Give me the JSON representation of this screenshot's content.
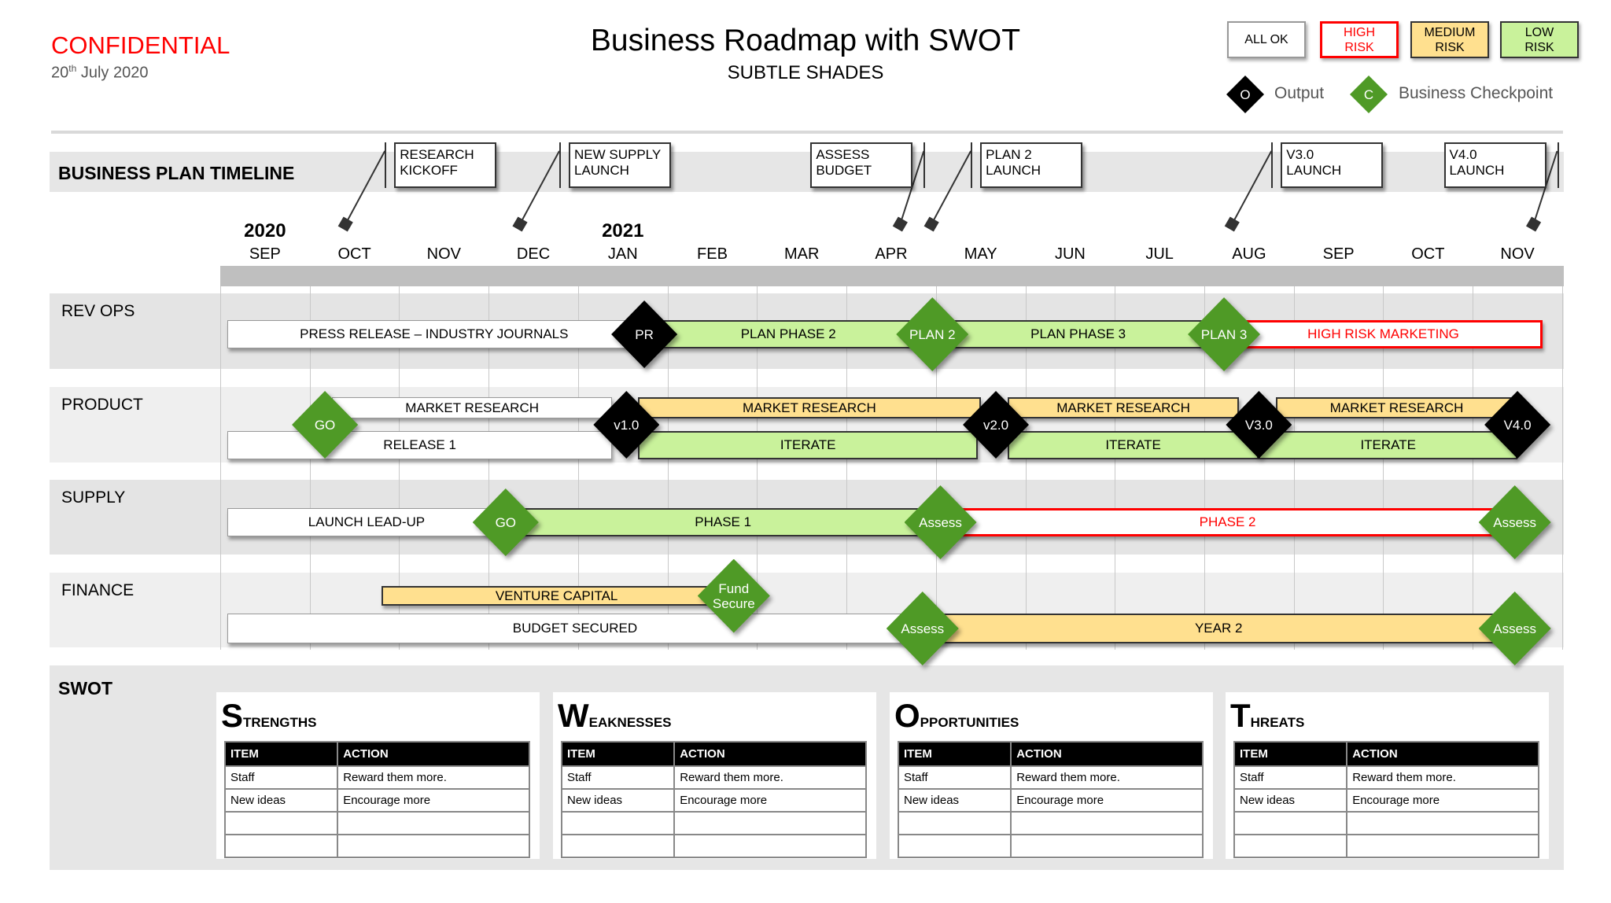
{
  "header": {
    "confidential": "CONFIDENTIAL",
    "date_day": "20",
    "date_suffix": "th",
    "date_rest": " July 2020",
    "title": "Business Roadmap with SWOT",
    "subtitle": "SUBTLE SHADES"
  },
  "legend": {
    "status": [
      {
        "key": "ok",
        "label": "ALL OK"
      },
      {
        "key": "high",
        "label": "HIGH RISK"
      },
      {
        "key": "medium",
        "label": "MEDIUM RISK"
      },
      {
        "key": "low",
        "label": "LOW RISK"
      }
    ],
    "output": {
      "symbol": "O",
      "label": "Output"
    },
    "checkpoint": {
      "symbol": "C",
      "label": "Business Checkpoint"
    }
  },
  "colors": {
    "high_risk": "#ff0000",
    "medium_risk": "#ffe08f",
    "low_risk": "#c9f29b",
    "checkpoint": "#4f9a26",
    "output": "#000000",
    "band": "#e6e6e6"
  },
  "timeline": {
    "title": "BUSINESS PLAN TIMELINE",
    "years": [
      {
        "label": "2020",
        "month_index": 0
      },
      {
        "label": "2021",
        "month_index": 4
      }
    ],
    "months": [
      "SEP",
      "OCT",
      "NOV",
      "DEC",
      "JAN",
      "FEB",
      "MAR",
      "APR",
      "MAY",
      "JUN",
      "JUL",
      "AUG",
      "SEP",
      "OCT",
      "NOV"
    ],
    "milestones": [
      {
        "label": "RESEARCH KICKOFF",
        "line1": "RESEARCH",
        "line2": "KICKOFF",
        "month": 1.4
      },
      {
        "label": "NEW SUPPLY LAUNCH",
        "line1": "NEW SUPPLY",
        "line2": "LAUNCH",
        "month": 3.35
      },
      {
        "label": "ASSESS BUDGET",
        "line1": "ASSESS",
        "line2": "BUDGET",
        "month": 7.6
      },
      {
        "label": "PLAN 2 LAUNCH",
        "line1": "PLAN 2",
        "line2": "LAUNCH",
        "month": 7.95
      },
      {
        "label": "V3.0 LAUNCH",
        "line1": "V3.0",
        "line2": "LAUNCH",
        "month": 11.31
      },
      {
        "label": "V4.0 LAUNCH",
        "line1": "V4.0",
        "line2": "LAUNCH",
        "month": 14.68
      }
    ]
  },
  "rows": [
    {
      "label": "REV OPS",
      "bars": [
        {
          "label": "PRESS RELEASE – INDUSTRY JOURNALS",
          "status": "ok",
          "start": 0.08,
          "end": 4.7,
          "lane": "mid"
        },
        {
          "label": "PLAN PHASE 2",
          "status": "low",
          "start": 4.74,
          "end": 7.96,
          "lane": "mid"
        },
        {
          "label": "PLAN PHASE 3",
          "status": "low",
          "start": 7.96,
          "end": 11.22,
          "lane": "mid"
        },
        {
          "label": "HIGH RISK MARKETING",
          "status": "high",
          "start": 11.22,
          "end": 14.78,
          "lane": "mid"
        }
      ],
      "markers": [
        {
          "type": "output",
          "label": "PR",
          "month": 4.74,
          "lane": "mid"
        },
        {
          "type": "checkpoint",
          "label": "PLAN 2",
          "month": 7.96,
          "lane": "mid"
        },
        {
          "type": "checkpoint",
          "label": "PLAN 3",
          "month": 11.22,
          "lane": "mid"
        }
      ]
    },
    {
      "label": "PRODUCT",
      "bars": [
        {
          "label": "MARKET RESEARCH",
          "status": "ok",
          "start": 1.25,
          "end": 4.38,
          "lane": "top"
        },
        {
          "label": "RELEASE 1",
          "status": "ok",
          "start": 0.08,
          "end": 4.38,
          "lane": "bottom"
        },
        {
          "label": "MARKET RESEARCH",
          "status": "medium",
          "start": 4.67,
          "end": 8.5,
          "lane": "top"
        },
        {
          "label": "ITERATE",
          "status": "low",
          "start": 4.67,
          "end": 8.47,
          "lane": "bottom"
        },
        {
          "label": "MARKET RESEARCH",
          "status": "medium",
          "start": 8.8,
          "end": 11.39,
          "lane": "top"
        },
        {
          "label": "ITERATE",
          "status": "low",
          "start": 8.8,
          "end": 11.61,
          "lane": "bottom"
        },
        {
          "label": "MARKET RESEARCH",
          "status": "medium",
          "start": 11.8,
          "end": 14.5,
          "lane": "top"
        },
        {
          "label": "ITERATE",
          "status": "low",
          "start": 11.61,
          "end": 14.5,
          "lane": "bottom"
        }
      ],
      "markers": [
        {
          "type": "checkpoint",
          "label": "GO",
          "month": 1.17,
          "lane": "center"
        },
        {
          "type": "output",
          "label": "v1.0",
          "month": 4.54,
          "lane": "center"
        },
        {
          "type": "output",
          "label": "v2.0",
          "month": 8.67,
          "lane": "center"
        },
        {
          "type": "output",
          "label": "V3.0",
          "month": 11.61,
          "lane": "center"
        },
        {
          "type": "output",
          "label": "V4.0",
          "month": 14.5,
          "lane": "center"
        }
      ]
    },
    {
      "label": "SUPPLY",
      "bars": [
        {
          "label": "LAUNCH LEAD-UP",
          "status": "ok",
          "start": 0.08,
          "end": 3.19,
          "lane": "mid"
        },
        {
          "label": "PHASE 1",
          "status": "low",
          "start": 3.19,
          "end": 8.05,
          "lane": "mid"
        },
        {
          "label": "PHASE 2",
          "status": "high",
          "start": 8.05,
          "end": 14.47,
          "lane": "mid"
        }
      ],
      "markers": [
        {
          "type": "checkpoint",
          "label": "GO",
          "month": 3.19,
          "lane": "mid"
        },
        {
          "type": "checkpoint",
          "label": "Assess",
          "month": 8.05,
          "lane": "mid"
        },
        {
          "type": "checkpoint",
          "label": "Assess",
          "month": 14.47,
          "lane": "mid"
        }
      ]
    },
    {
      "label": "FINANCE",
      "bars": [
        {
          "label": "VENTURE CAPITAL",
          "status": "medium",
          "start": 1.8,
          "end": 5.72,
          "lane": "top"
        },
        {
          "label": "BUDGET SECURED",
          "status": "ok",
          "start": 0.08,
          "end": 7.85,
          "lane": "bottom"
        },
        {
          "label": "YEAR 2",
          "status": "medium",
          "start": 7.85,
          "end": 14.47,
          "lane": "bottom"
        }
      ],
      "markers": [
        {
          "type": "checkpoint",
          "label": "Fund Secure",
          "month": 5.74,
          "lane": "top"
        },
        {
          "type": "checkpoint",
          "label": "Assess",
          "month": 7.85,
          "lane": "bottom"
        },
        {
          "type": "checkpoint",
          "label": "Assess",
          "month": 14.47,
          "lane": "bottom"
        }
      ]
    }
  ],
  "swot": {
    "title": "SWOT",
    "panels": [
      {
        "initial": "S",
        "rest": "TRENGTHS",
        "columns": [
          "ITEM",
          "ACTION"
        ],
        "rows": [
          [
            "Staff",
            "Reward them more."
          ],
          [
            "New ideas",
            "Encourage more"
          ],
          [
            "",
            ""
          ],
          [
            "",
            ""
          ]
        ]
      },
      {
        "initial": "W",
        "rest": "EAKNESSES",
        "columns": [
          "ITEM",
          "ACTION"
        ],
        "rows": [
          [
            "Staff",
            "Reward them more."
          ],
          [
            "New ideas",
            "Encourage more"
          ],
          [
            "",
            ""
          ],
          [
            "",
            ""
          ]
        ]
      },
      {
        "initial": "O",
        "rest": "PPORTUNITIES",
        "columns": [
          "ITEM",
          "ACTION"
        ],
        "rows": [
          [
            "Staff",
            "Reward them more."
          ],
          [
            "New ideas",
            "Encourage more"
          ],
          [
            "",
            ""
          ],
          [
            "",
            ""
          ]
        ]
      },
      {
        "initial": "T",
        "rest": "HREATS",
        "columns": [
          "ITEM",
          "ACTION"
        ],
        "rows": [
          [
            "Staff",
            "Reward them more."
          ],
          [
            "New ideas",
            "Encourage more"
          ],
          [
            "",
            ""
          ],
          [
            "",
            ""
          ]
        ]
      }
    ]
  }
}
